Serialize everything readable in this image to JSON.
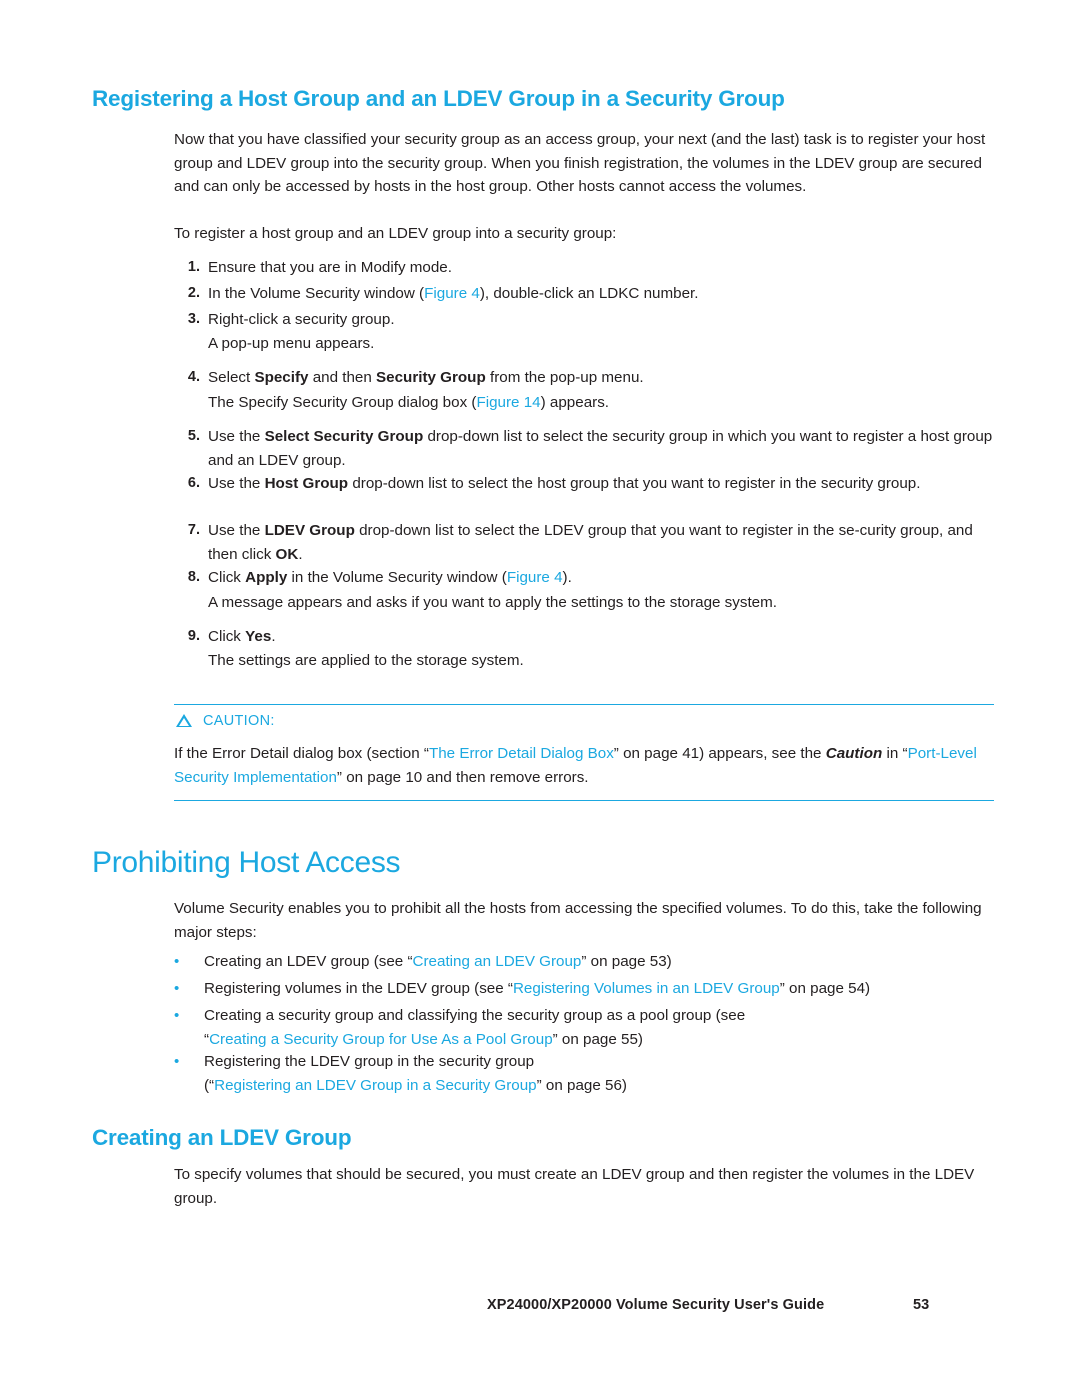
{
  "section1": {
    "heading": "Registering a Host Group and an LDEV Group in a Security Group",
    "intro": "Now that you have classified your security group as an access group, your next (and the last) task is to register your host group and LDEV group into the security group. When you finish registration, the volumes in the LDEV group are secured and can only be accessed by hosts in the host group. Other hosts cannot access the volumes.",
    "lead_in": "To register a host group and an LDEV group into a security group:",
    "steps": [
      {
        "num": "1.",
        "text": "Ensure that you are in Modify mode."
      },
      {
        "num": "2.",
        "text": "In the Volume Security window (Figure 4), double-click an LDKC number."
      },
      {
        "num": "3.",
        "text": "Right-click a security group."
      },
      {
        "num": "4.",
        "text": "Select Specify and then Security Group from the pop-up menu."
      },
      {
        "num": "5.",
        "text": "Use the Select Security Group drop-down list to select the security group in which you want to register a host group and an LDEV group."
      },
      {
        "num": "6.",
        "text": "Use the Host Group drop-down list to select the host group that you want to register in the security group."
      },
      {
        "num": "7.",
        "text": "Use the LDEV Group drop-down list to select the LDEV group that you want to register in the security group, and then click OK."
      },
      {
        "num": "8.",
        "text": "Click Apply in the Volume Security window (Figure 4)."
      },
      {
        "num": "9.",
        "text": "Click Yes."
      }
    ],
    "sub_step3": "A pop-up menu appears.",
    "sub_step4": "The Specify Security Group dialog box (Figure 14) appears.",
    "sub_step8": "A message appears and asks if you want to apply the settings to the storage system.",
    "sub_step9": "The settings are applied to the storage system.",
    "caution": {
      "label": "CAUTION:",
      "line1_a": "If the Error Detail dialog box (section “",
      "line1_link": "The Error Detail Dialog Box",
      "line1_b": "” on page 41) appears, see",
      "line2_a": "the ",
      "line2_caution_word": "Caution",
      "line2_b": " in “",
      "line2_link": "Port-Level Security Implementation",
      "line2_c": "” on page 10 and then remove errors."
    }
  },
  "section2": {
    "heading": "Prohibiting Host Access",
    "intro": "Volume Security enables you to prohibit all the hosts from accessing the specified volumes. To do this, take the following major steps:",
    "bullets": [
      {
        "pre": "Creating an LDEV group (see “",
        "link": "Creating an LDEV Group",
        "post": "” on page 53)"
      },
      {
        "pre": "Registering volumes in the LDEV group (see “",
        "link": "Registering Volumes in an LDEV Group",
        "post": "” on page 54)"
      },
      {
        "pre": "Creating a security group and classifying the security group as a pool group (see",
        "link": "Creating a Security Group for Use As a Pool Group",
        "post": "” on page 55)",
        "line2_prefix": "“"
      },
      {
        "pre": "Registering the LDEV group in the security group",
        "link": "Registering an LDEV Group in a Security Group",
        "post": "” on page 56)",
        "line2_prefix": "(“"
      }
    ]
  },
  "section3": {
    "heading": "Creating an LDEV Group",
    "intro": "To specify volumes that should be secured, you must create an LDEV group and then register the volumes in the LDEV group."
  },
  "footer": {
    "title": "XP24000/XP20000 Volume Security User's Guide",
    "page": "53"
  }
}
